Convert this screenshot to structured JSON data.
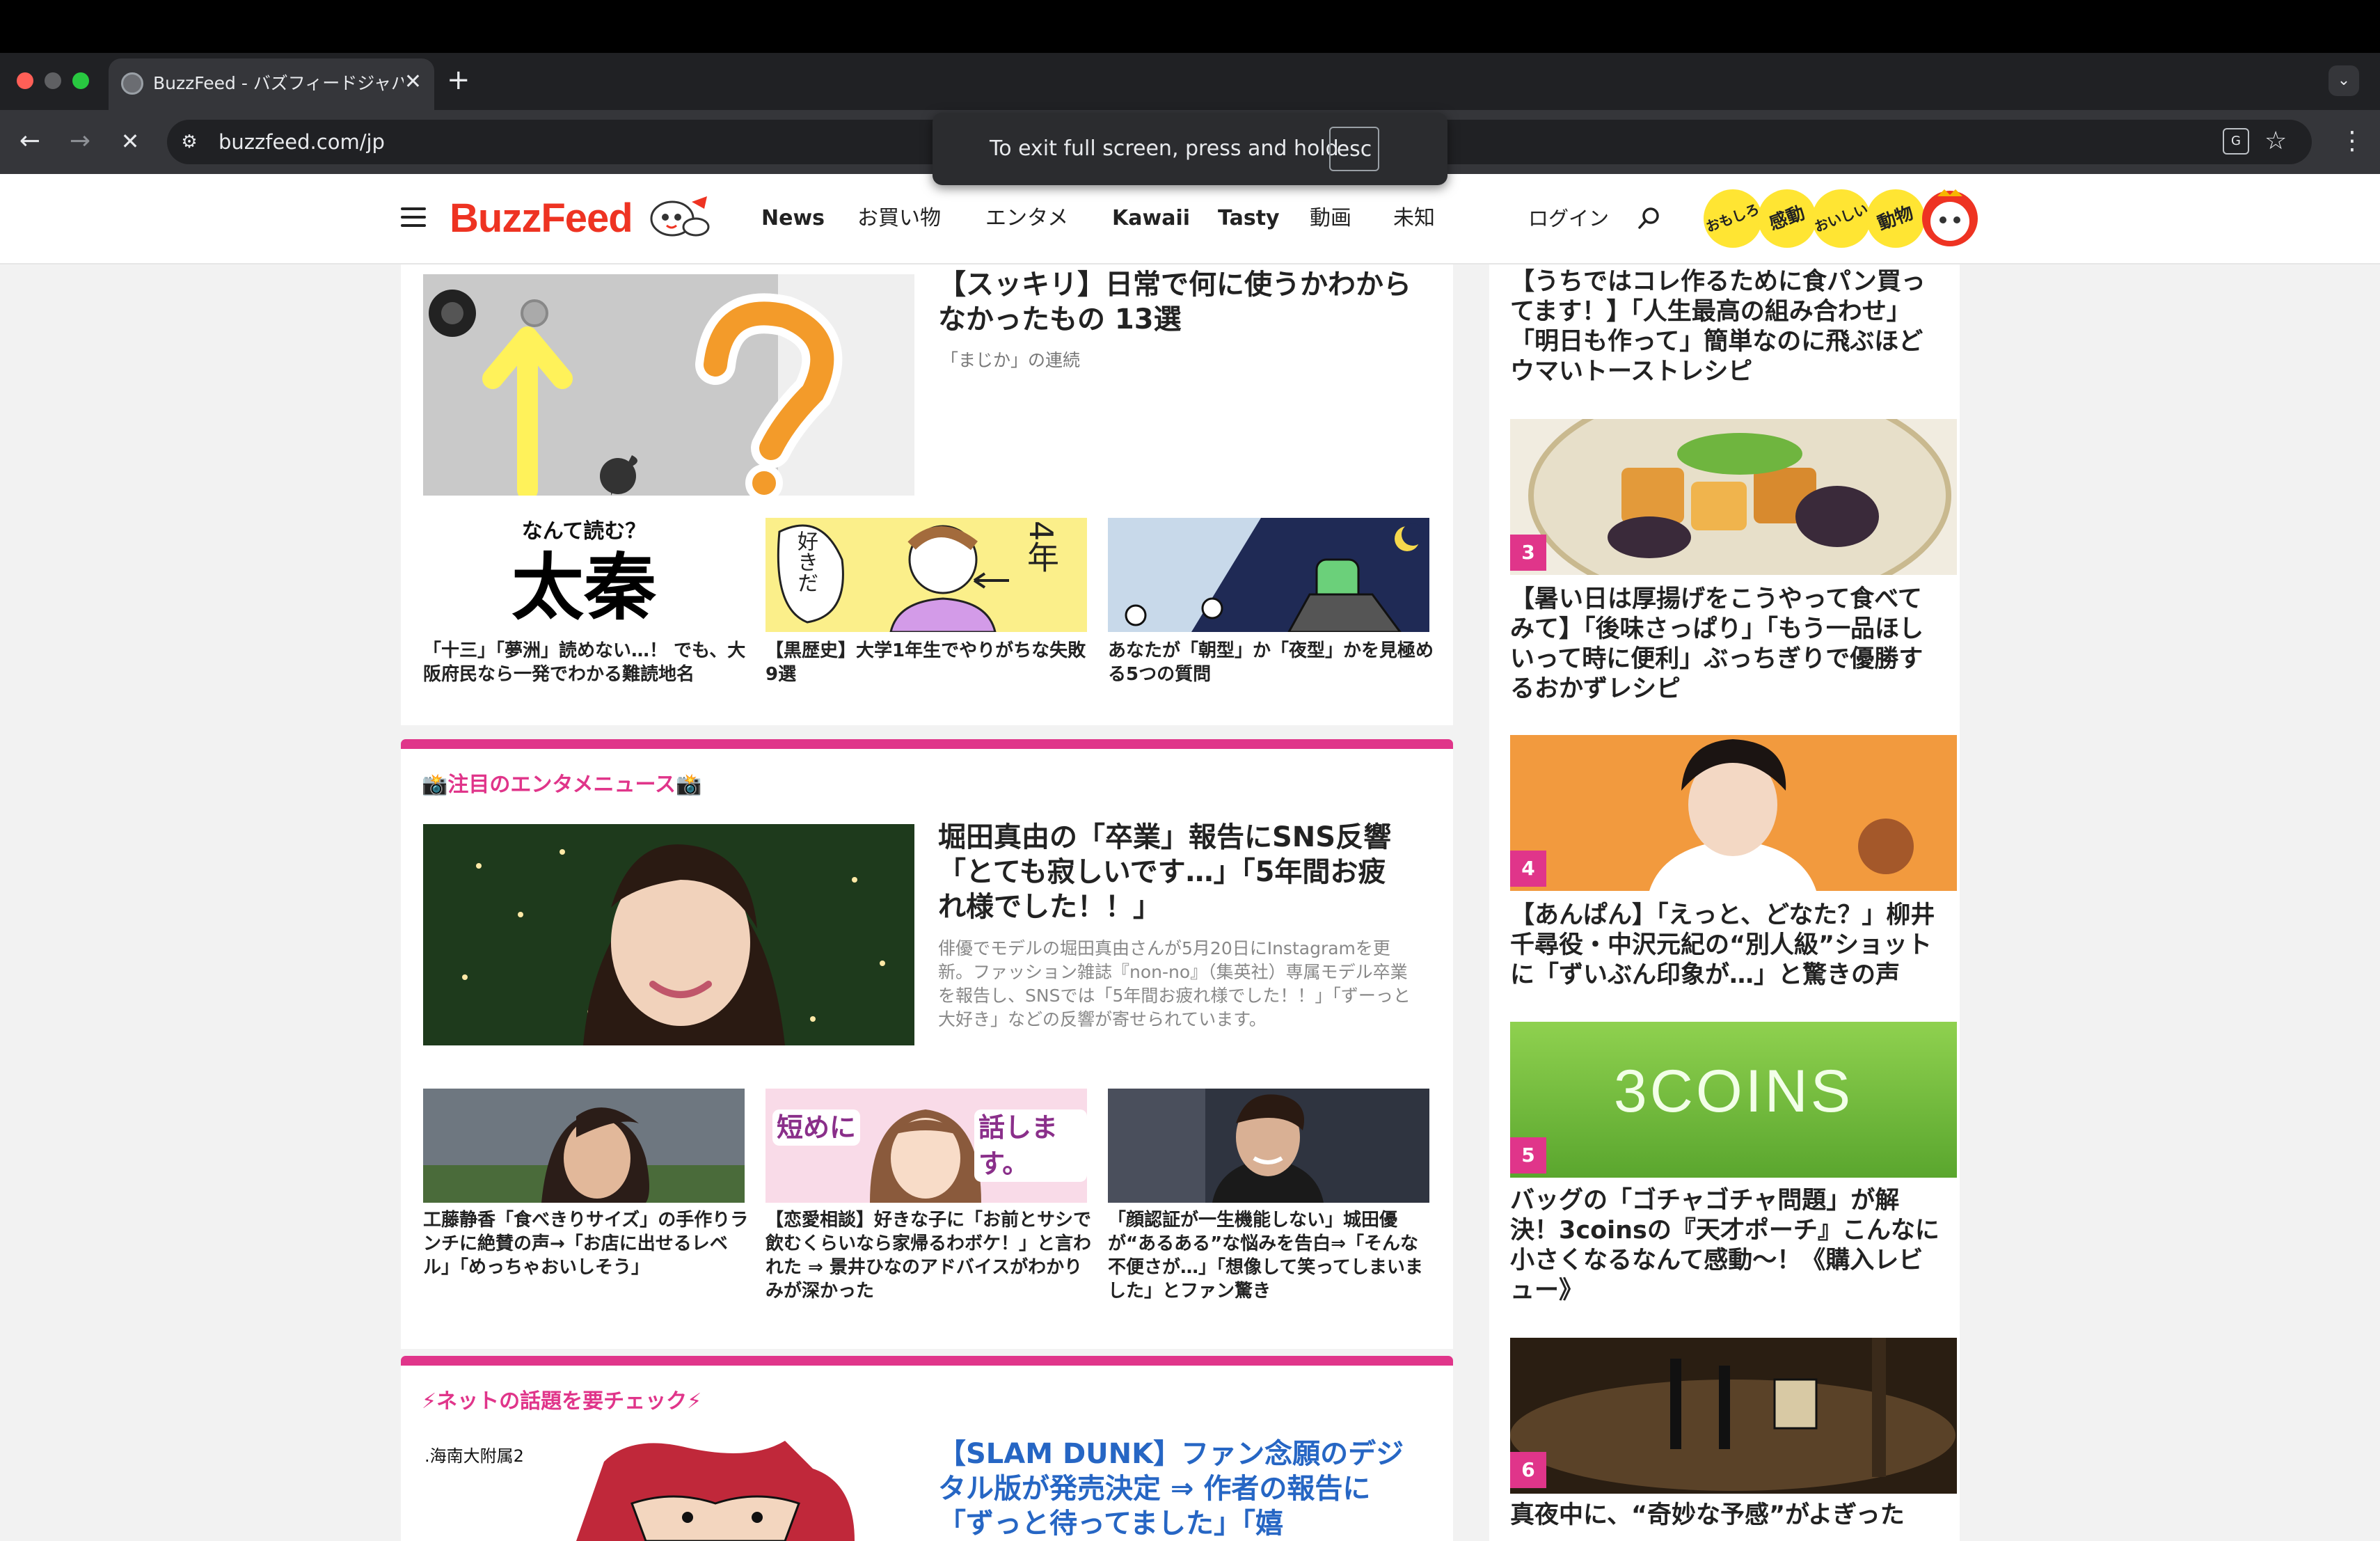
{
  "browser": {
    "tab_title": "BuzzFeed - バズフィードジャパン",
    "tab_close": "✕",
    "new_tab": "+",
    "tab_list": "⌄",
    "url": "buzzfeed.com/jp",
    "back": "←",
    "forward": "→",
    "stop": "✕",
    "fullscreen_popup": {
      "text": "To exit full screen, press and hold",
      "key": "esc"
    }
  },
  "header": {
    "logo": "BuzzFeed",
    "nav": [
      "News",
      "お買い物",
      "エンタメ",
      "Kawaii",
      "Tasty",
      "動画",
      "未知"
    ],
    "login": "ログイン",
    "badges": [
      "おもしろ",
      "感動",
      "おいしい",
      "動物"
    ]
  },
  "top_section": {
    "featured": {
      "title": "【スッキリ】日常で何に使うかわからなかったもの 13選",
      "sub": "「まじか」の連続"
    },
    "kanji_card": {
      "prompt": "なんて読む？",
      "kanji": "太秦"
    },
    "cards": [
      {
        "title": "「十三」「夢洲」読めない…！ でも、大阪府民なら一発でわかる難読地名"
      },
      {
        "title": "【黒歴史】大学1年生でやりがちな失敗 9選"
      },
      {
        "title": "あなたが「朝型」か「夜型」かを見極める5つの質問"
      }
    ],
    "comic_text": {
      "speech": "好きだ",
      "label": "4年"
    }
  },
  "entertainment": {
    "section_title": "📸注目のエンタメニュース📸",
    "featured": {
      "title": "堀田真由の「卒業」報告にSNS反響「とても寂しいです…」「5年間お疲れ様でした！！」",
      "desc": "俳優でモデルの堀田真由さんが5月20日にInstagramを更新。ファッション雑誌『non-no』（集英社）専属モデル卒業を報告し、SNSでは「5年間お疲れ様でした！！」「ずーっと大好き」などの反響が寄せられています。"
    },
    "cards": [
      {
        "title": "工藤静香「食べきりサイズ」の手作りランチに絶賛の声→「お店に出せるレベル」「めっちゃおいしそう」"
      },
      {
        "title": "【恋愛相談】好きな子に「お前とサシで飲むくらいなら家帰るわボケ！」と言われた ⇒ 景井ひなのアドバイスがわかりみが深かった"
      },
      {
        "title": "「顔認証が一生機能しない」城田優が“あるある”な悩みを告白⇒「そんな不便さが…」「想像して笑ってしまいました」とファン驚き"
      }
    ],
    "thumb_text": {
      "left": "短めに",
      "right": "話します。"
    }
  },
  "net_topics": {
    "section_title": "⚡ネットの話題を要チェック⚡",
    "featured": {
      "title": "【SLAM DUNK】ファン念願のデジタル版が発売決定 ⇒ 作者の報告に「ずっと待ってました」「嬉"
    },
    "thumb_caption": ".海南大附属2"
  },
  "sidebar": {
    "items": [
      {
        "rank": "",
        "title": "【うちではコレ作るために食パン買ってます！】「人生最高の組み合わせ」「明日も作って」簡単なのに飛ぶほどウマいトーストレシピ"
      },
      {
        "rank": "3",
        "title": "【暑い日は厚揚げをこうやって食べてみて】「後味さっぱり」「もう一品ほしいって時に便利」ぶっちぎりで優勝するおかずレシピ"
      },
      {
        "rank": "4",
        "title": "【あんぱん】「えっと、どなた？」柳井千尋役・中沢元紀の“別人級”ショットに「ずいぶん印象が…」と驚きの声"
      },
      {
        "rank": "5",
        "title": "バッグの「ゴチャゴチャ問題」が解決！3coinsの『天才ポーチ』こんなに小さくなるなんて感動〜！《購入レビュー》"
      },
      {
        "rank": "6",
        "title": "真夜中に、“奇妙な予感”がよぎった"
      }
    ],
    "coins_sign": "3COINS"
  }
}
